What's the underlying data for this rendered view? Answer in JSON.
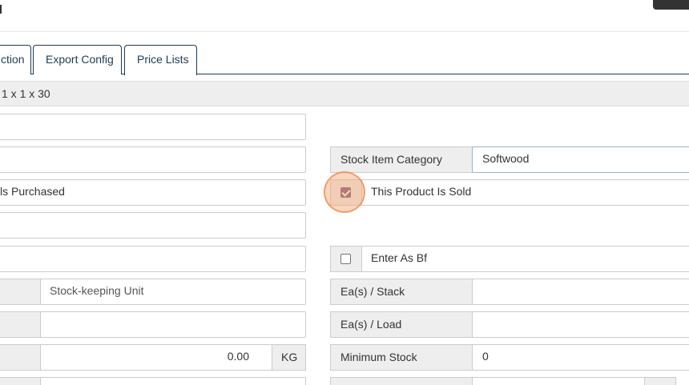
{
  "tabs": {
    "partial_tab": "ction",
    "export_config": "Export Config",
    "price_lists": "Price Lists"
  },
  "info_bar": {
    "text": "1 x 1 x 30"
  },
  "form": {
    "stock_item_category": {
      "label": "Stock Item Category",
      "value": "Softwood"
    },
    "purchased_partial_label": "ls Purchased",
    "product_is_sold": {
      "label": "This Product Is Sold",
      "checked": true
    },
    "enter_as_bf": {
      "label": "Enter As Bf",
      "checked": false
    },
    "stock_keeping_unit": {
      "placeholder": "Stock-keeping Unit"
    },
    "eas_per_stack": {
      "label": "Ea(s) / Stack",
      "value": ""
    },
    "eas_per_load": {
      "label": "Ea(s) / Load",
      "value": ""
    },
    "weight": {
      "value": "0.00",
      "unit": "KG"
    },
    "minimum_stock": {
      "label": "Minimum Stock",
      "value": "0"
    }
  },
  "colors": {
    "accent": "#1c3c58",
    "checkbox_checked": "#7b5a80",
    "highlight": "#f4a46e"
  }
}
